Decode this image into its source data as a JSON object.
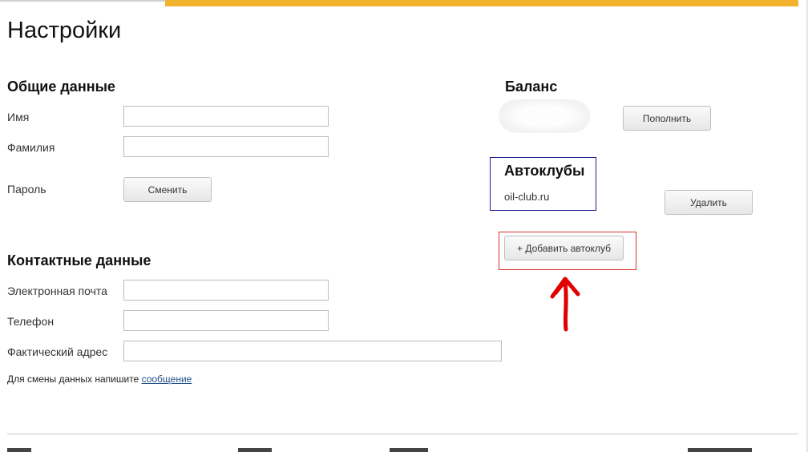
{
  "page": {
    "title": "Настройки"
  },
  "general": {
    "title": "Общие данные",
    "first_name_label": "Имя",
    "first_name_value": "",
    "last_name_label": "Фамилия",
    "last_name_value": "",
    "password_label": "Пароль",
    "change_button": "Сменить"
  },
  "contacts": {
    "title": "Контактные данные",
    "email_label": "Электронная почта",
    "email_value": "",
    "phone_label": "Телефон",
    "phone_value": "",
    "address_label": "Фактический адрес",
    "address_value": "",
    "note_text": "Для смены данных напишите ",
    "note_link": "сообщение"
  },
  "balance": {
    "title": "Баланс",
    "topup_button": "Пополнить"
  },
  "autoclubs": {
    "title": "Автоклубы",
    "items": [
      "oil-club.ru"
    ],
    "delete_button": "Удалить",
    "add_button": "+ Добавить автоклуб"
  },
  "colors": {
    "accent_bar": "#f4b32e",
    "highlight_blue": "#1c1c8c",
    "highlight_red": "#d63030",
    "annotation_arrow": "#e00000",
    "link": "#1f4f8a"
  },
  "icons": {
    "annotation": "up-arrow-icon"
  }
}
